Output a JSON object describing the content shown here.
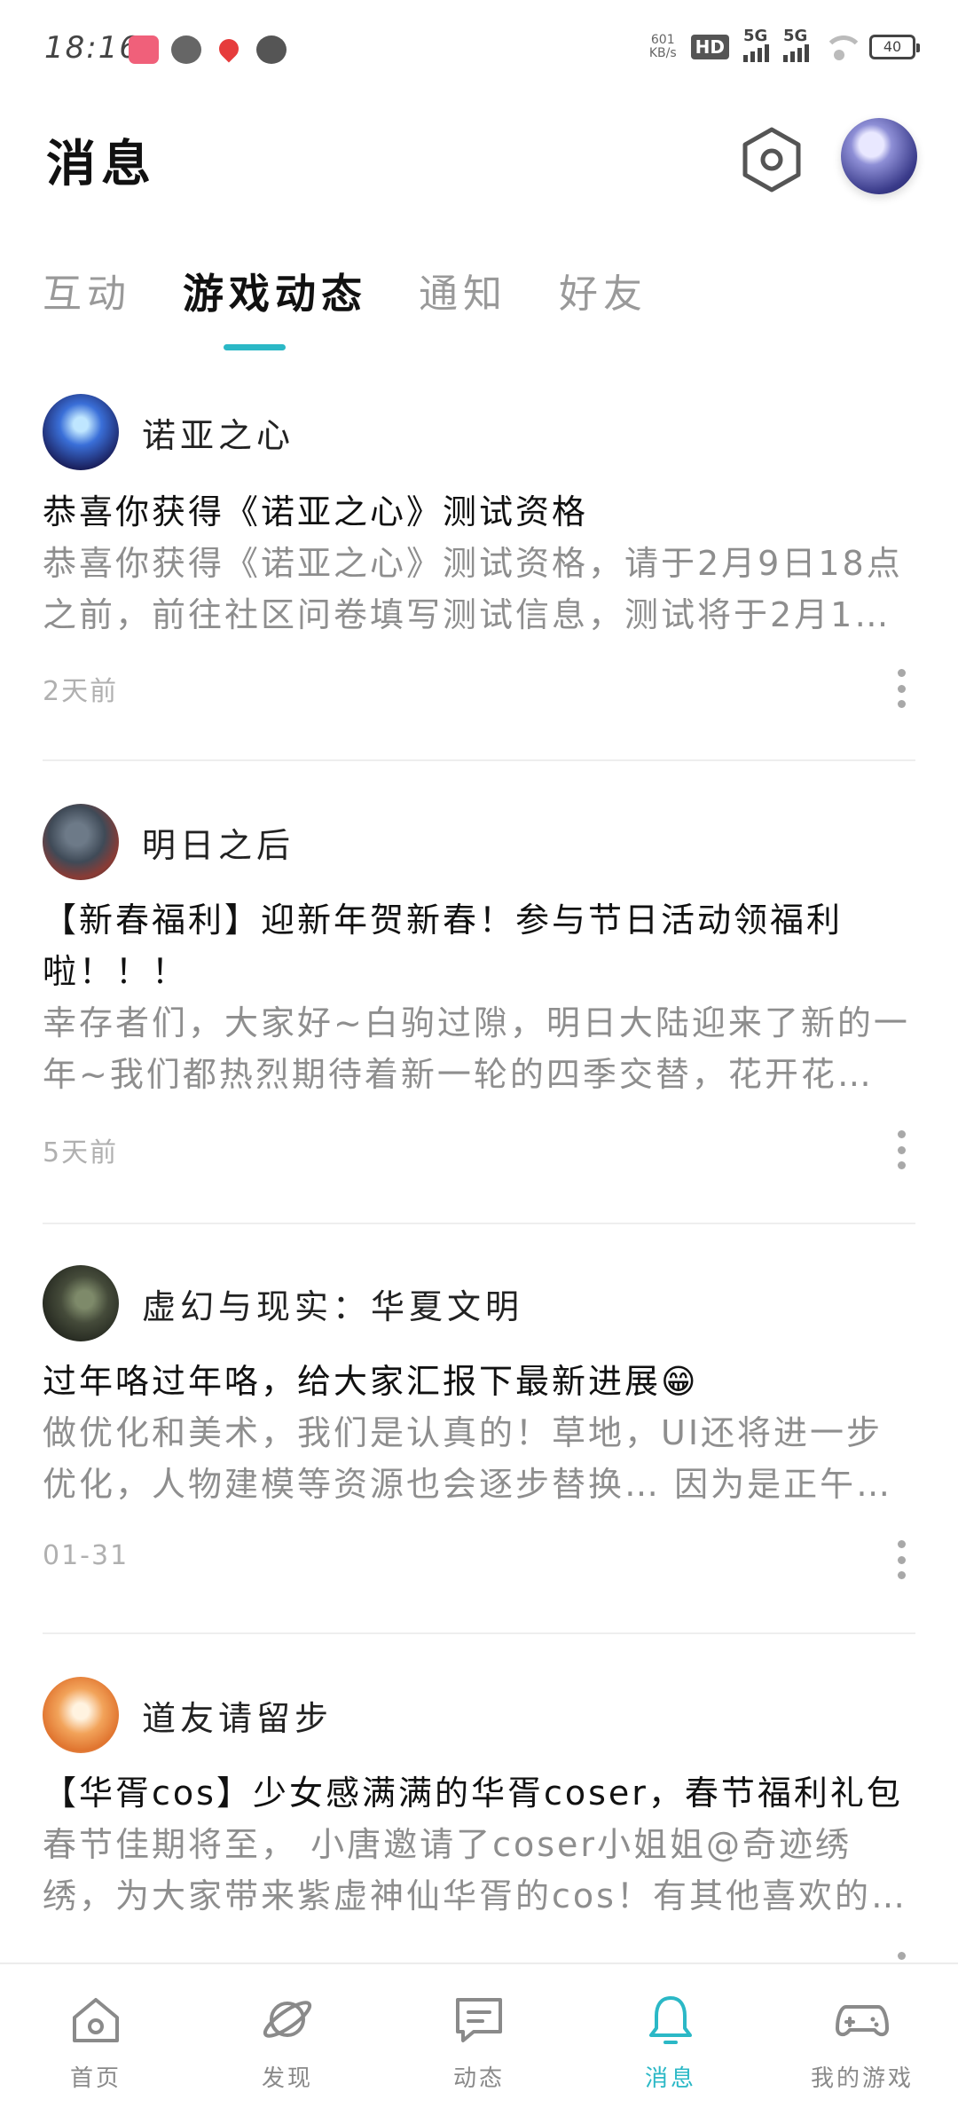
{
  "status_bar": {
    "time": "18:16",
    "net_speed_value": "601",
    "net_speed_unit": "KB/s",
    "hd_label": "HD",
    "sim1_label": "5G",
    "sim2_label": "5G",
    "sim_index": "1\n2",
    "battery": "40",
    "icons": [
      "bilibili-notification-icon",
      "wechat-notification-icon",
      "map-pin-notification-icon",
      "chat-bubble-notification-icon"
    ]
  },
  "header": {
    "title": "消息",
    "settings_icon": "gear-icon"
  },
  "tabs": [
    {
      "label": "互动",
      "active": false
    },
    {
      "label": "游戏动态",
      "active": true
    },
    {
      "label": "通知",
      "active": false
    },
    {
      "label": "好友",
      "active": false
    }
  ],
  "accent_color": "#2bb8c6",
  "feed": [
    {
      "game": "诺亚之心",
      "title": "恭喜你获得《诺亚之心》测试资格",
      "body": "恭喜你获得《诺亚之心》测试资格，请于2月9日18点之前，前往社区问卷填写测试信息，测试将于2月1…",
      "time": "2天前"
    },
    {
      "game": "明日之后",
      "title": "【新春福利】迎新年贺新春！参与节日活动领福利啦！！！",
      "body": "幸存者们，大家好~白驹过隙，明日大陆迎来了新的一年~我们都热烈期待着新一轮的四季交替，花开花…",
      "time": "5天前"
    },
    {
      "game": "虚幻与现实：华夏文明",
      "title": "过年咯过年咯，给大家汇报下最新进展😁",
      "body": "做优化和美术，我们是认真的！草地，UI还将进一步优化，人物建模等资源也会逐步替换… 因为是正午…",
      "time": "01-31"
    },
    {
      "game": "道友请留步",
      "title": "【华胥cos】少女感满满的华胥coser，春节福利礼包",
      "body": "春节佳期将至， 小唐邀请了coser小姐姐@奇迹绣绣，为大家带来紫虚神仙华胥的cos！有其他喜欢的cos…",
      "time": ""
    }
  ],
  "bottom_nav": [
    {
      "label": "首页",
      "icon": "home-icon",
      "active": false
    },
    {
      "label": "发现",
      "icon": "planet-icon",
      "active": false
    },
    {
      "label": "动态",
      "icon": "message-square-icon",
      "active": false
    },
    {
      "label": "消息",
      "icon": "bell-icon",
      "active": true
    },
    {
      "label": "我的游戏",
      "icon": "gamepad-icon",
      "active": false
    }
  ]
}
